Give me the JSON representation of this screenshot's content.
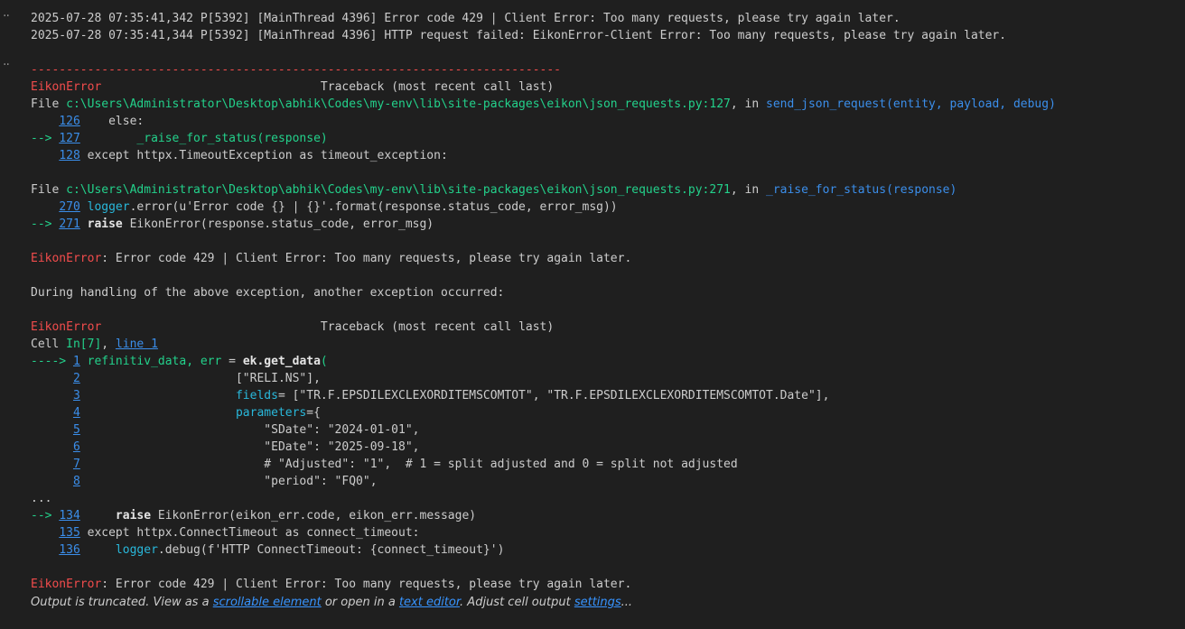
{
  "log": {
    "line1": "2025-07-28 07:35:41,342 P[5392] [MainThread 4396] Error code 429 | Client Error: Too many requests, please try again later.",
    "line2": "2025-07-28 07:35:41,344 P[5392] [MainThread 4396] HTTP request failed: EikonError-Client Error: Too many requests, please try again later."
  },
  "traceback": {
    "separator": "---------------------------------------------------------------------------",
    "error_name": "EikonError",
    "header_pad": "                               ",
    "header": "Traceback (most recent call last)",
    "frame1": {
      "file_label": "File ",
      "path": "c:\\Users\\Administrator\\Desktop\\abhik\\Codes\\my-env\\lib\\site-packages\\eikon\\json_requests.py:127",
      "in_label": ", in ",
      "func": "send_json_request",
      "args": "(entity, payload, debug)",
      "lines": [
        {
          "arrow": "    ",
          "num": "126",
          "code": "    else:"
        },
        {
          "arrow": "--> ",
          "num": "127",
          "code": "        _raise_for_status(response)"
        },
        {
          "arrow": "    ",
          "num": "128",
          "code": " except httpx.TimeoutException as timeout_exception:"
        }
      ]
    },
    "frame2": {
      "file_label": "File ",
      "path": "c:\\Users\\Administrator\\Desktop\\abhik\\Codes\\my-env\\lib\\site-packages\\eikon\\json_requests.py:271",
      "in_label": ", in ",
      "func": "_raise_for_status",
      "args": "(response)",
      "l270_arrow": "    ",
      "l270_num": "270",
      "l270_obj": " logger",
      "l270_rest": ".error(u'Error code {} | {}'.format(response.status_code, error_msg))",
      "l271_arrow": "--> ",
      "l271_num": "271",
      "l271_kw": " raise",
      "l271_rest": " EikonError(response.status_code, error_msg)"
    },
    "error_message": ": Error code 429 | Client Error: Too many requests, please try again later.",
    "during": "During handling of the above exception, another exception occurred:",
    "cell": {
      "label": "Cell ",
      "in": "In[7]",
      "sep": ", ",
      "line": "line 1"
    },
    "cell_lines": {
      "l1_arrow": "----> ",
      "l1_num": "1",
      "l1_var": " refinitiv_data, err ",
      "l1_eq": "=",
      "l1_call": " ek.get_data",
      "l1_paren": "(",
      "l2_pad": "      ",
      "l2_num": "2",
      "l2_code": "                      [\"RELI.NS\"],",
      "l3_num": "3",
      "l3_kw": "                      fields",
      "l3_rest": "= [\"TR.F.EPSDILEXCLEXORDITEMSCOMTOT\", \"TR.F.EPSDILEXCLEXORDITEMSCOMTOT.Date\"],",
      "l4_num": "4",
      "l4_kw": "                      parameters",
      "l4_rest": "={",
      "l5_num": "5",
      "l5_code": "                          \"SDate\": \"2024-01-01\",",
      "l6_num": "6",
      "l6_code": "                          \"EDate\": \"2025-09-18\",",
      "l7_num": "7",
      "l7_code": "                          # \"Adjusted\": \"1\",  # 1 = split adjusted and 0 = split not adjusted",
      "l8_num": "8",
      "l8_code": "                          \"period\": \"FQ0\","
    },
    "ellipsis": "...",
    "tail": {
      "l134_arrow": "--> ",
      "l134_num": "134",
      "l134_kw": "     raise",
      "l134_rest": " EikonError(eikon_err.code, eikon_err.message)",
      "l135_arrow": "    ",
      "l135_num": "135",
      "l135_code": " except httpx.ConnectTimeout as connect_timeout:",
      "l136_arrow": "    ",
      "l136_num": "136",
      "l136_obj": "     logger",
      "l136_rest": ".debug(f'HTTP ConnectTimeout: {connect_timeout}')"
    }
  },
  "footer": {
    "prefix": "Output is truncated. View as a ",
    "link1": "scrollable element",
    "mid1": " or open in a ",
    "link2": "text editor",
    "mid2": ". Adjust cell output ",
    "link3": "settings",
    "suffix": "..."
  },
  "gutter": {
    "dots": "··"
  }
}
